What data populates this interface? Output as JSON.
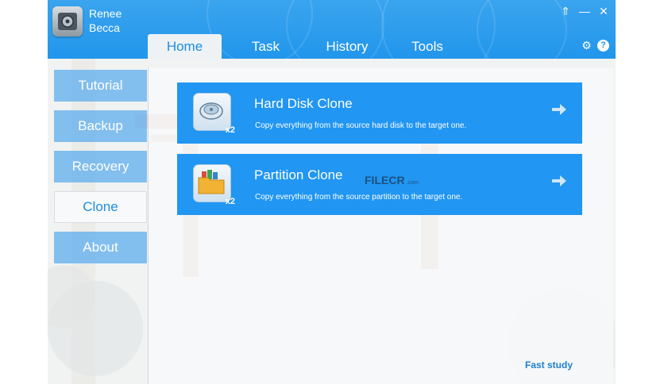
{
  "app": {
    "name_line1": "Renee",
    "name_line2": "Becca"
  },
  "window_buttons": {
    "skin": "⇑",
    "minimize": "—",
    "close": "✕"
  },
  "tabs": [
    {
      "label": "Home",
      "active": true
    },
    {
      "label": "Task"
    },
    {
      "label": "History"
    },
    {
      "label": "Tools"
    }
  ],
  "sidebar": [
    {
      "label": "Tutorial"
    },
    {
      "label": "Backup"
    },
    {
      "label": "Recovery"
    },
    {
      "label": "Clone",
      "active": true
    },
    {
      "label": "About"
    }
  ],
  "cards": [
    {
      "title": "Hard Disk Clone",
      "description": "Copy everything from the source hard disk to the target one.",
      "badge": "x2",
      "icon": "hard-disk-icon"
    },
    {
      "title": "Partition Clone",
      "description": "Copy everything from the source partition to the target one.",
      "badge": "x2",
      "icon": "folder-icon"
    }
  ],
  "watermark": {
    "text": "FILECR",
    "suffix": ".com"
  },
  "footer": {
    "fast_study": "Fast study"
  },
  "colors": {
    "titlebar": "#2196eb",
    "card": "#2196f3",
    "sidebar_item": "#6eb5ec",
    "accent_text": "#1e8fe0"
  }
}
